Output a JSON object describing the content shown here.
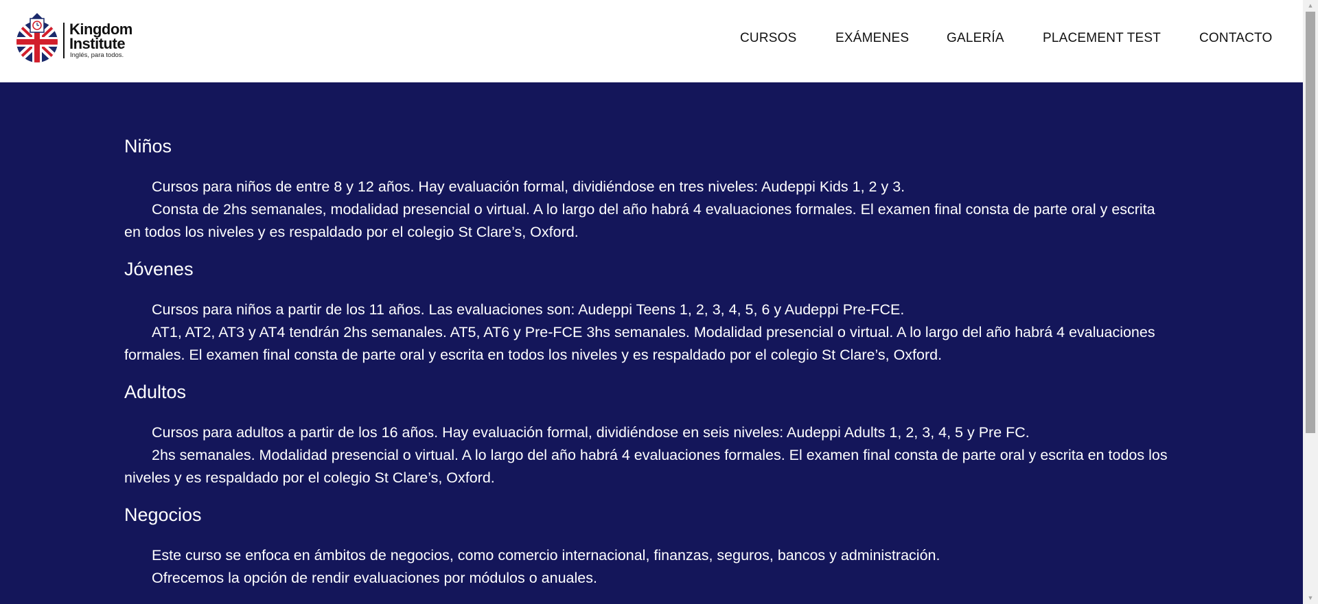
{
  "header": {
    "logo": {
      "name": "Kingdom\nInstitute",
      "tagline": "Inglés, para todos."
    },
    "nav": [
      {
        "label": "CURSOS"
      },
      {
        "label": "EXÁMENES"
      },
      {
        "label": "GALERÍA"
      },
      {
        "label": "PLACEMENT TEST"
      },
      {
        "label": "CONTACTO"
      }
    ]
  },
  "sections": [
    {
      "title": "Niños",
      "paragraphs": [
        "Cursos para niños de entre 8 y 12 años. Hay evaluación formal, dividiéndose en tres niveles: Audeppi Kids 1, 2 y 3.",
        "Consta de 2hs semanales, modalidad presencial o virtual. A lo largo del año habrá 4 evaluaciones formales. El examen final consta de parte oral y escrita en todos los niveles y es respaldado por el colegio St Clare’s, Oxford."
      ]
    },
    {
      "title": "Jóvenes",
      "paragraphs": [
        "Cursos para niños a partir de los 11 años. Las evaluaciones son: Audeppi Teens 1, 2, 3, 4, 5, 6 y Audeppi Pre-FCE.",
        "AT1, AT2, AT3 y AT4 tendrán 2hs semanales. AT5, AT6 y Pre-FCE 3hs semanales. Modalidad presencial o virtual. A lo largo del año habrá 4 evaluaciones formales. El examen final consta de parte oral y escrita en todos los niveles y es respaldado por el colegio St Clare’s, Oxford."
      ]
    },
    {
      "title": "Adultos",
      "paragraphs": [
        "Cursos para adultos a partir de los 16 años. Hay evaluación formal, dividiéndose en seis niveles: Audeppi Adults 1, 2, 3, 4, 5 y Pre FC.",
        "2hs semanales. Modalidad presencial o virtual. A lo largo del año habrá 4 evaluaciones formales. El examen final consta de parte oral y escrita en todos los niveles y es respaldado por el colegio St Clare’s, Oxford."
      ]
    },
    {
      "title": "Negocios",
      "paragraphs": [
        "Este curso se enfoca en ámbitos de negocios, como comercio internacional, finanzas, seguros, bancos y administración.",
        "Ofrecemos la opción de rendir evaluaciones por módulos o anuales."
      ]
    }
  ],
  "colors": {
    "background": "#14165a",
    "header": "#ffffff",
    "flag_blue": "#1b2a6b",
    "flag_red": "#d21f2c"
  },
  "icons": {
    "logo": "union-jack-clock-logo-icon"
  }
}
